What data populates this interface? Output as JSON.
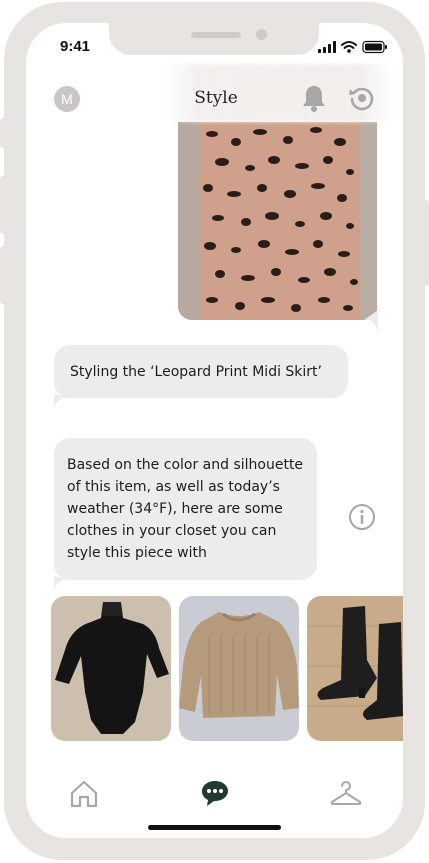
{
  "status_bar": {
    "time": "9:41"
  },
  "header": {
    "avatar_initial": "M",
    "title": "Style"
  },
  "chat": {
    "user_image": "leopard-print-skirt-photo",
    "message_1": "Styling the ‘Leopard Print Midi Skirt’",
    "message_2": "Based on the color and silhouette of this item, as well as today’s weather (34°F), here are some clothes in your closet you can style this piece with",
    "suggestions": [
      {
        "item": "black-bodysuit-photo"
      },
      {
        "item": "tan-knit-sweater-photo"
      },
      {
        "item": "black-knee-boots-photo"
      }
    ]
  },
  "nav": {
    "items": [
      {
        "icon": "home-icon",
        "active": false
      },
      {
        "icon": "chat-bubble-icon",
        "active": true
      },
      {
        "icon": "hanger-icon",
        "active": false
      }
    ]
  },
  "colors": {
    "frame": "#e8e4e1",
    "bubble": "#ececec",
    "accent": "#1f3a32",
    "icon_gray": "#a9a7a5"
  }
}
